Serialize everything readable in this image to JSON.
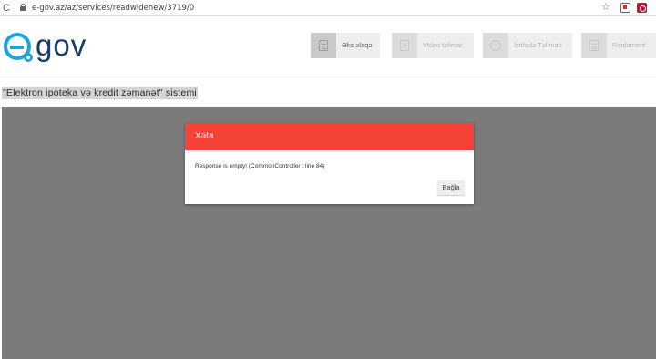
{
  "browser": {
    "url": "e-gov.az/az/services/readwidenew/3719/0",
    "reload_glyph": "C",
    "star_glyph": "☆"
  },
  "site": {
    "logo_text": "gov"
  },
  "nav": [
    {
      "label": "Əks əlaqə",
      "icon": "feedback-doc-icon",
      "active": true
    },
    {
      "label": "Video təlimat",
      "icon": "video-icon",
      "active": false
    },
    {
      "label": "İstifadə Təlimatı",
      "icon": "info-icon",
      "active": false
    },
    {
      "label": "Reqlament",
      "icon": "document-icon",
      "active": false
    }
  ],
  "page": {
    "title": "\"Elektron ipoteka və kredit zəmanət\" sistemi"
  },
  "modal": {
    "title": "Xəta",
    "message": "Response is empty! (CommonController : line 84)",
    "close_label": "Bağla"
  },
  "colors": {
    "modal_header": "#f44336",
    "overlay": "#7b7b7b",
    "logo_blue": "#1ea7d6",
    "logo_text": "#173a6b"
  }
}
